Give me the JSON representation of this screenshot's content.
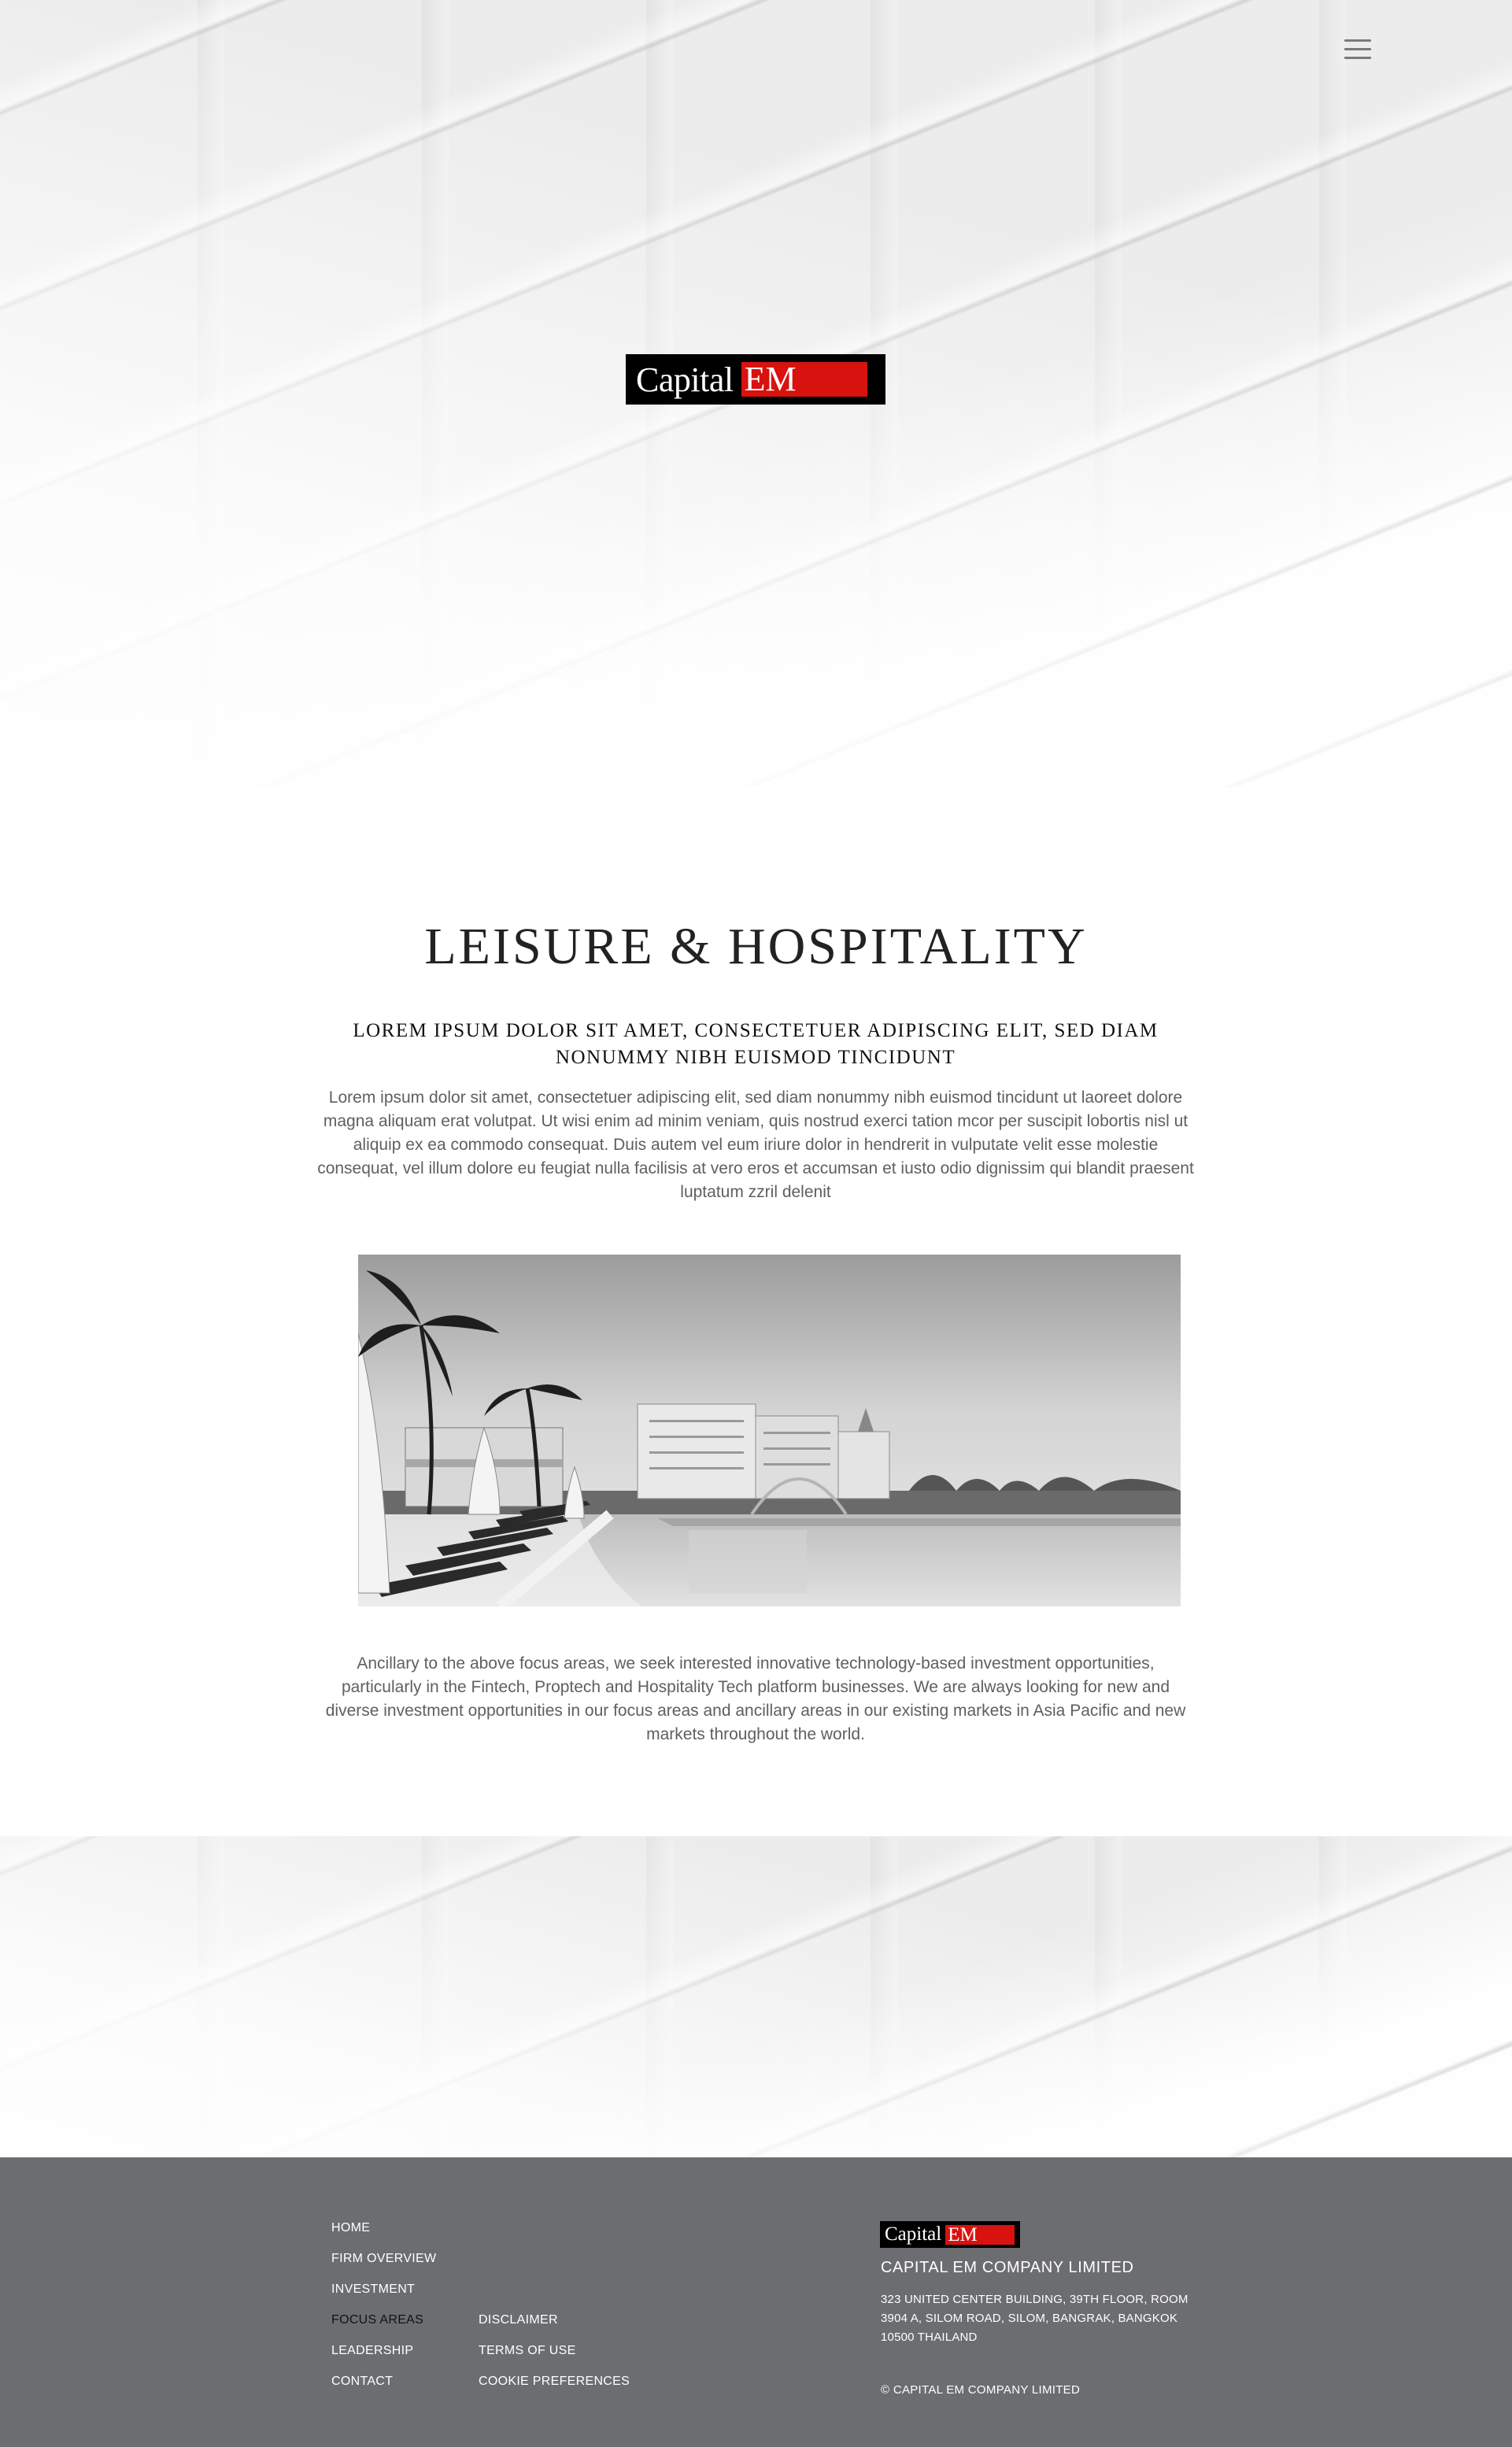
{
  "header": {
    "menu_icon": "hamburger-menu-icon",
    "logo": {
      "word1": "Capital",
      "word2": "EM"
    }
  },
  "main": {
    "title": "LEISURE  & HOSPITALITY",
    "subtitle": "LOREM IPSUM DOLOR SIT AMET, CONSECTETUER ADIPISCING ELIT, SED DIAM NONUMMY NIBH EUISMOD TINCIDUNT",
    "intro": "Lorem ipsum dolor sit amet, consectetuer adipiscing elit, sed diam nonummy nibh euismod tincidunt ut laoreet dolore magna aliquam erat volutpat. Ut wisi enim ad minim veniam, quis nostrud exerci tation mcor per suscipit lobortis nisl ut aliquip ex ea commodo consequat. Duis autem vel eum iriure dolor in hendrerit in vulputate velit esse molestie consequat, vel illum dolore eu feugiat nulla facilisis at vero eros et accumsan et iusto odio dignissim qui blandit praesent luptatum zzril delenit",
    "body": "Ancillary to the above focus areas, we seek interested innovative technology-based investment opportunities, particularly in the Fintech, Proptech and Hospitality Tech platform businesses. We are always looking for new and diverse investment opportunities in our focus areas and ancillary areas in our existing markets in Asia Pacific and new markets throughout the world."
  },
  "footer": {
    "nav_col1": [
      "HOME",
      "FIRM OVERVIEW",
      "INVESTMENT",
      "FOCUS AREAS",
      "LEADERSHIP",
      "CONTACT"
    ],
    "nav_col2": [
      "DISCLAIMER",
      "TERMS OF USE",
      "COOKIE PREFERENCES"
    ],
    "active_item": "FOCUS AREAS",
    "logo": {
      "word1": "Capital",
      "word2": "EM"
    },
    "company_name": "CAPITAL EM COMPANY LIMITED",
    "address": "323 UNITED CENTER BUILDING, 39TH FLOOR, ROOM 3904 A, SILOM ROAD, SILOM, BANGRAK, BANGKOK 10500 THAILAND",
    "copyright": "© CAPITAL EM COMPANY LIMITED"
  },
  "colors": {
    "brand_red": "#d8120f",
    "footer_bg": "#6c6d71",
    "active_link": "#111111"
  }
}
